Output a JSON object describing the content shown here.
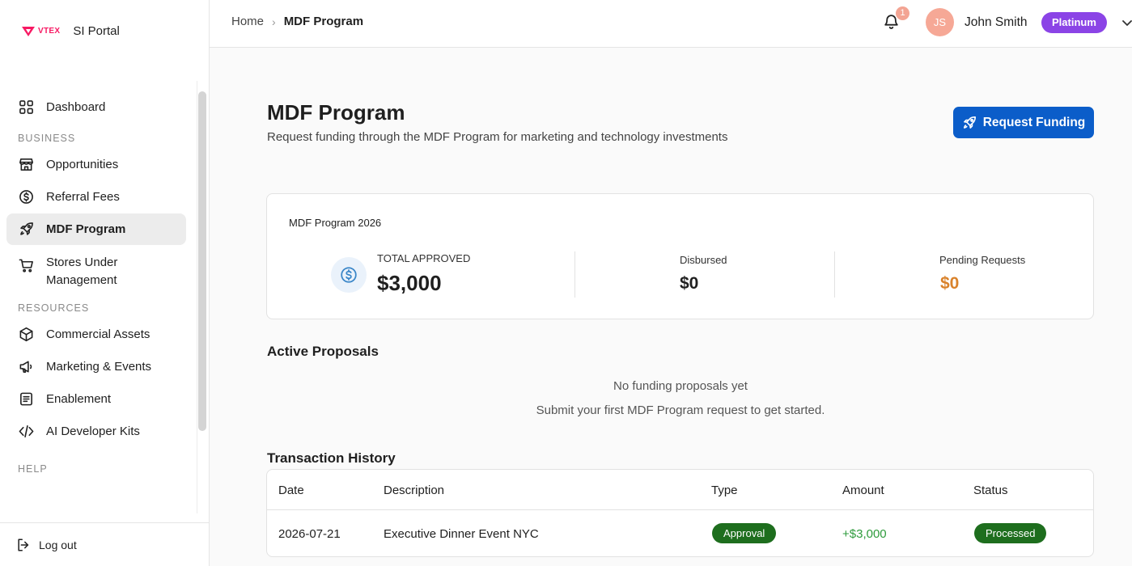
{
  "app": {
    "brand_logo": "VTEX",
    "brand_name": "SI Portal"
  },
  "sidebar": {
    "dashboard": "Dashboard",
    "section_business": "BUSINESS",
    "opportunities": "Opportunities",
    "referral_fees": "Referral Fees",
    "mdf_program": "MDF Program",
    "stores_under_management_line1": "Stores Under",
    "stores_under_management_line2": "Management",
    "section_resources": "RESOURCES",
    "commercial_assets": "Commercial Assets",
    "marketing_events": "Marketing & Events",
    "enablement": "Enablement",
    "ai_developer_kits": "AI Developer Kits",
    "section_help": "HELP",
    "log_out": "Log out",
    "active_item": "MDF Program"
  },
  "topbar": {
    "breadcrumb_home": "Home",
    "breadcrumb_separator": "›",
    "breadcrumb_current": "MDF Program",
    "notification_count": "1",
    "avatar_initials": "JS",
    "user_name": "John Smith",
    "tier": "Platinum"
  },
  "main": {
    "title": "MDF Program",
    "subtitle": "Request funding through the MDF Program for marketing and technology investments",
    "request_button": "Request Funding",
    "stats": {
      "heading": "MDF Program 2026",
      "total_approved_label": "TOTAL APPROVED",
      "total_approved_value": "$3,000",
      "disbursed_label": "Disbursed",
      "disbursed_value": "$0",
      "pending_label": "Pending Requests",
      "pending_value": "$0"
    },
    "active_proposals": {
      "title": "Active Proposals",
      "empty_title": "No funding proposals yet",
      "empty_subtitle": "Submit your first MDF Program request to get started."
    },
    "transactions": {
      "title": "Transaction History",
      "columns": [
        "Date",
        "Description",
        "Type",
        "Amount",
        "Status"
      ],
      "rows": [
        {
          "date": "2026-07-21",
          "description": "Executive Dinner Event NYC",
          "type": "Approval",
          "amount": "+$3,000",
          "status": "Processed"
        }
      ]
    }
  },
  "colors": {
    "primary": "#0b5dc9",
    "tier_badge": "#8b44e6",
    "pending_value": "#d9822b",
    "amount_positive": "#2e9b3c",
    "status_pill": "#1e6e1e",
    "brand": "#f71963"
  }
}
